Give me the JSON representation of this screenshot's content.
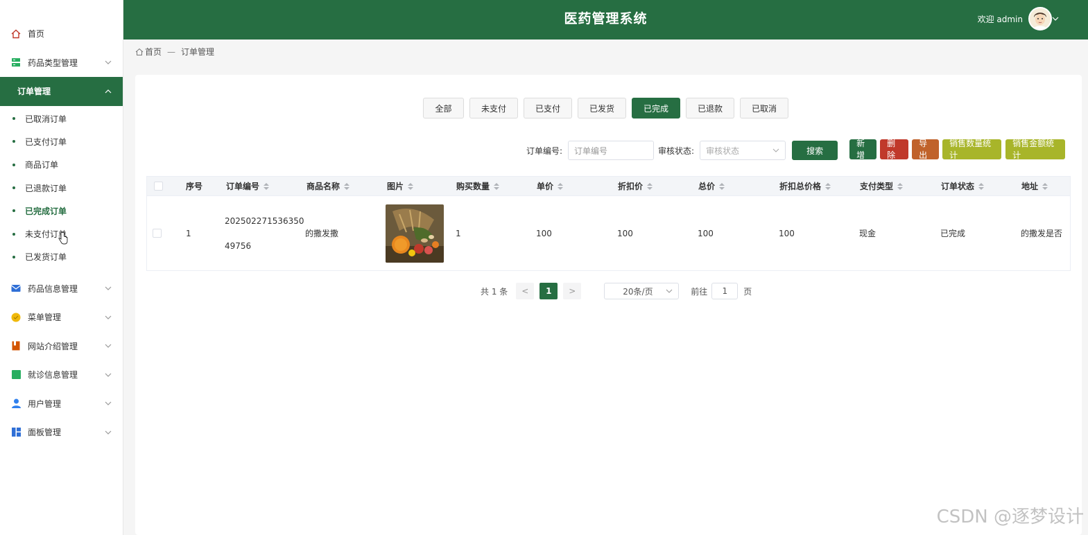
{
  "header": {
    "title": "医药管理系统",
    "welcome": "欢迎 admin"
  },
  "breadcrumb": {
    "home": "首页",
    "sep": "—",
    "current": "订单管理"
  },
  "sidebar": {
    "items": [
      {
        "label": "首页",
        "icon": "home-icon",
        "color": "#c0392b"
      },
      {
        "label": "药品类型管理",
        "icon": "server-icon",
        "color": "#27ae60"
      },
      {
        "label": "订单管理",
        "active": true
      }
    ],
    "sub_items": [
      {
        "label": "已取消订单"
      },
      {
        "label": "已支付订单"
      },
      {
        "label": "商品订单"
      },
      {
        "label": "已退款订单"
      },
      {
        "label": "已完成订单",
        "active": true
      },
      {
        "label": "未支付订单"
      },
      {
        "label": "已发货订单"
      }
    ],
    "lower_items": [
      {
        "label": "药品信息管理",
        "icon": "mail-icon",
        "color": "#2f6fd6"
      },
      {
        "label": "菜单管理",
        "icon": "circle-icon",
        "color": "#f0b90b"
      },
      {
        "label": "网站介绍管理",
        "icon": "bookmark-icon",
        "color": "#d35400"
      },
      {
        "label": "就诊信息管理",
        "icon": "square-icon",
        "color": "#27ae60"
      },
      {
        "label": "用户管理",
        "icon": "user-icon",
        "color": "#2f80ed"
      },
      {
        "label": "面板管理",
        "icon": "dashboard-icon",
        "color": "#2f6fd6"
      }
    ]
  },
  "filters": [
    "全部",
    "未支付",
    "已支付",
    "已发货",
    "已完成",
    "已退款",
    "已取消"
  ],
  "search": {
    "order_no_label": "订单编号:",
    "order_no_placeholder": "订单编号",
    "status_label": "审核状态:",
    "status_placeholder": "审核状态",
    "search_btn": "搜索"
  },
  "actions": [
    {
      "label": "新增",
      "color": "#266e42"
    },
    {
      "label": "删除",
      "color": "#c0392b"
    },
    {
      "label": "导出",
      "color": "#c0622b"
    },
    {
      "label": "销售数量统计",
      "color": "#a8b52a"
    },
    {
      "label": "销售金额统计",
      "color": "#a8b52a"
    }
  ],
  "table": {
    "columns": [
      "序号",
      "订单编号",
      "商品名称",
      "图片",
      "购买数量",
      "单价",
      "折扣价",
      "总价",
      "折扣总价格",
      "支付类型",
      "订单状态",
      "地址"
    ],
    "rows": [
      {
        "index": "1",
        "order_no_1": "202502271536350",
        "order_no_2": "49756",
        "product": "的撒发撒",
        "qty": "1",
        "price": "100",
        "discount_price": "100",
        "total": "100",
        "discount_total": "100",
        "pay_type": "现金",
        "status": "已完成",
        "address": "的撒发是否"
      }
    ]
  },
  "pager": {
    "total": "共 1 条",
    "prev": "<",
    "page": "1",
    "next": ">",
    "size": "20条/页",
    "goto": "前往",
    "goto_val": "1",
    "page_unit": "页"
  },
  "watermark": "CSDN @逐梦设计"
}
